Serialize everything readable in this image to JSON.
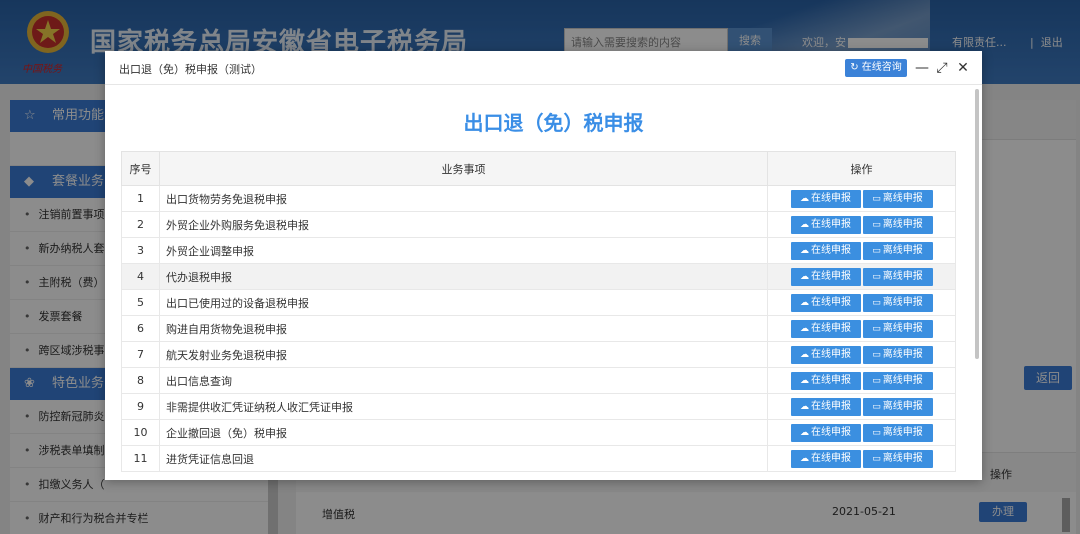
{
  "header": {
    "site_title": "国家税务总局安徽省电子税务局",
    "emblem_text": "中国税务",
    "search_placeholder": "请输入需要搜索的内容",
    "search_button": "搜索",
    "welcome": "欢迎，安",
    "user_tail": "有限责任...",
    "separator": "|",
    "logout": "退出"
  },
  "sidebar": {
    "sections": [
      {
        "icon": "☆",
        "label": "常用功能"
      },
      {
        "icon": "◆",
        "label": "套餐业务"
      },
      {
        "icon": "❀",
        "label": "特色业务"
      }
    ],
    "package_items": [
      "注销前置事项",
      "新办纳税人套餐",
      "主附税（费）",
      "发票套餐",
      "跨区域涉税事"
    ],
    "special_items": [
      "防控新冠肺炎",
      "涉税表单填制",
      "扣缴义务人（",
      "财产和行为税合并专栏"
    ],
    "bullet": "•"
  },
  "main": {
    "return_button": "返回",
    "lower_table": {
      "op_header": "操作",
      "row": {
        "tax": "增值税",
        "date": "2021-05-21",
        "action": "办理"
      }
    }
  },
  "modal": {
    "title": "出口退（免）税申报（测试）",
    "consult_button": "在线咨询",
    "minimize_icon": "—",
    "maximize_icon": "⤢",
    "close_icon": "✕",
    "heading": "出口退（免）税申报",
    "columns": {
      "seq": "序号",
      "item": "业务事项",
      "ops": "操作"
    },
    "online_label": "在线申报",
    "offline_label": "离线申报",
    "rows": [
      {
        "seq": "1",
        "name": "出口货物劳务免退税申报"
      },
      {
        "seq": "2",
        "name": "外贸企业外购服务免退税申报"
      },
      {
        "seq": "3",
        "name": "外贸企业调整申报"
      },
      {
        "seq": "4",
        "name": "代办退税申报"
      },
      {
        "seq": "5",
        "name": "出口已使用过的设备退税申报"
      },
      {
        "seq": "6",
        "name": "购进自用货物免退税申报"
      },
      {
        "seq": "7",
        "name": "航天发射业务免退税申报"
      },
      {
        "seq": "8",
        "name": "出口信息查询"
      },
      {
        "seq": "9",
        "name": "非需提供收汇凭证纳税人收汇凭证申报"
      },
      {
        "seq": "10",
        "name": "企业撤回退（免）税申报"
      },
      {
        "seq": "11",
        "name": "进货凭证信息回退"
      }
    ],
    "highlight_row": 4
  }
}
